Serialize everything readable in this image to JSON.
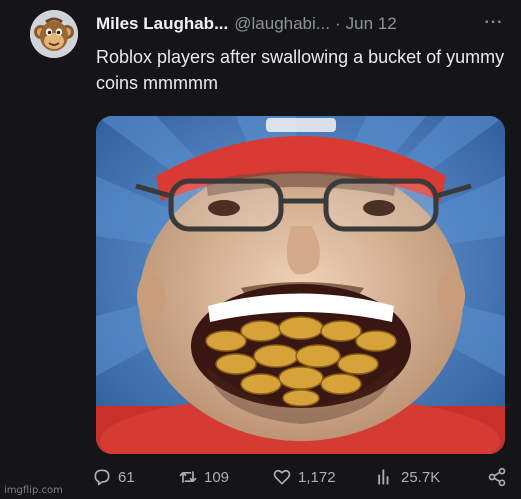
{
  "tweet": {
    "display_name": "Miles Laughab...",
    "handle": "@laughabi...",
    "separator": "·",
    "date": "Jun 12",
    "more_icon": "more-horizontal-icon",
    "text": "Roblox players after swallowing a bucket of yummy coins mmmmm"
  },
  "actions": {
    "replies": {
      "icon": "reply-icon",
      "count": "61"
    },
    "retweets": {
      "icon": "retweet-icon",
      "count": "109"
    },
    "likes": {
      "icon": "like-icon",
      "count": "1,172"
    },
    "views": {
      "icon": "views-icon",
      "count": "25.7K"
    },
    "share": {
      "icon": "share-icon"
    }
  },
  "watermark": "imgflip.com",
  "colors": {
    "background": "#151517",
    "text": "#e7e9ea",
    "secondary": "#8b9299"
  }
}
